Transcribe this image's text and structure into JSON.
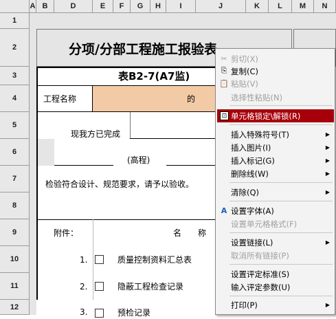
{
  "columns": [
    "A",
    "B",
    "D",
    "E",
    "F",
    "G",
    "H",
    "I",
    "J",
    "K",
    "L",
    "M",
    "N"
  ],
  "rows": [
    "1",
    "2",
    "3",
    "4",
    "5",
    "6",
    "7",
    "8",
    "9",
    "10",
    "11",
    "12"
  ],
  "form": {
    "title": "分项/分部工程施工报验表",
    "subtitle": "表B2-7(A7监)",
    "project_label": "工程名称",
    "project_value": "的",
    "completed_text": "现我方已完成",
    "elevation": "(高程)",
    "inspection_text": "检验符合设计、规范要求，请予以验收。",
    "attach_label": "附件：",
    "name_header": "名　　称",
    "items": [
      {
        "num": "1.",
        "text": "质量控制资料汇总表"
      },
      {
        "num": "2.",
        "text": "隐蔽工程检查记录"
      },
      {
        "num": "3.",
        "text": "预检记录"
      }
    ]
  },
  "context_menu": {
    "items": [
      {
        "label": "剪切(X)",
        "icon": "scissors-icon",
        "glyph": "✂",
        "disabled": true
      },
      {
        "label": "复制(C)",
        "icon": "copy-icon",
        "glyph": "⎘",
        "disabled": false
      },
      {
        "label": "粘贴(V)",
        "icon": "paste-icon",
        "glyph": "📋",
        "disabled": true
      },
      {
        "label": "选择性粘贴(N)",
        "disabled": true
      },
      {
        "label": "单元格锁定\\解锁(R)",
        "icon": "lock-icon",
        "glyph": "🔒",
        "highlighted": true
      },
      {
        "label": "插入特殊符号(T)",
        "submenu": true
      },
      {
        "label": "插入图片(I)",
        "submenu": true
      },
      {
        "label": "插入标记(G)",
        "submenu": true
      },
      {
        "label": "删除线(W)",
        "submenu": true
      },
      {
        "label": "清除(Q)",
        "submenu": true
      },
      {
        "label": "设置字体(A)",
        "icon": "font-icon",
        "glyph": "A"
      },
      {
        "label": "设置单元格格式(F)",
        "disabled": true
      },
      {
        "label": "设置链接(L)",
        "submenu": true
      },
      {
        "label": "取消所有链接(P)",
        "disabled": true
      },
      {
        "label": "设置评定标准(S)"
      },
      {
        "label": "输入评定参数(U)"
      },
      {
        "label": "打印(P)",
        "submenu": true
      }
    ]
  },
  "colors": {
    "highlight": "#a8000a",
    "project_fill": "#f2caa6",
    "title_fill": "#e5e5e5"
  }
}
